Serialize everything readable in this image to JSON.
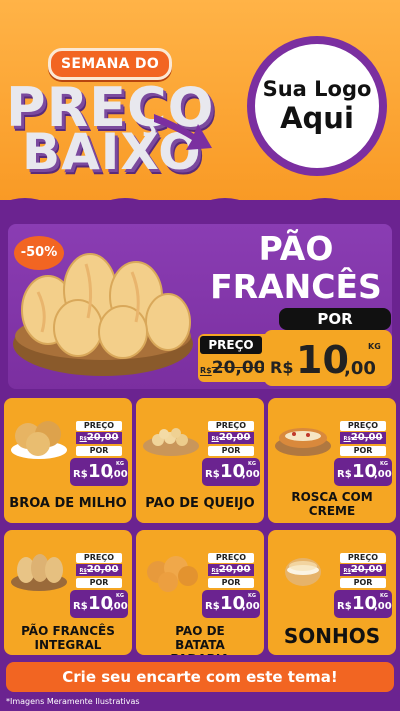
{
  "header": {
    "week_label": "SEMANA DO",
    "title_line1": "PREÇO",
    "title_line2": "BAIXO",
    "logo_line1": "Sua Logo",
    "logo_line2": "Aqui"
  },
  "hero": {
    "discount": "-50%",
    "title_line1": "PÃO",
    "title_line2": "FRANCÊS",
    "preco_label": "PREÇO",
    "old_currency": "R$",
    "old_price": "20,00",
    "por_label": "POR",
    "currency": "R$",
    "price_int": "10",
    "price_cents": ",00",
    "unit": "KG"
  },
  "cards": [
    {
      "name": "BROA DE MILHO",
      "preco_label": "PREÇO",
      "old_currency": "R$",
      "old_price": "20,00",
      "por_label": "POR",
      "currency": "R$",
      "price_int": "10",
      "price_cents": ",00",
      "unit": "KG"
    },
    {
      "name": "PAO DE QUEIJO",
      "preco_label": "PREÇO",
      "old_currency": "R$",
      "old_price": "20,00",
      "por_label": "POR",
      "currency": "R$",
      "price_int": "10",
      "price_cents": ",00",
      "unit": "KG"
    },
    {
      "name": "ROSCA COM CREME",
      "preco_label": "PREÇO",
      "old_currency": "R$",
      "old_price": "20,00",
      "por_label": "POR",
      "currency": "R$",
      "price_int": "10",
      "price_cents": ",00",
      "unit": "KG"
    },
    {
      "name": "PÃO FRANCÊS INTEGRAL",
      "preco_label": "PREÇO",
      "old_currency": "R$",
      "old_price": "20,00",
      "por_label": "POR",
      "currency": "R$",
      "price_int": "10",
      "price_cents": ",00",
      "unit": "KG"
    },
    {
      "name": "PAO DE BATATA PADARIA",
      "preco_label": "PREÇO",
      "old_currency": "R$",
      "old_price": "20,00",
      "por_label": "POR",
      "currency": "R$",
      "price_int": "10",
      "price_cents": ",00",
      "unit": "KG"
    },
    {
      "name": "SONHOS",
      "preco_label": "PREÇO",
      "old_currency": "R$",
      "old_price": "20,00",
      "por_label": "POR",
      "currency": "R$",
      "price_int": "10",
      "price_cents": ",00",
      "unit": "KG"
    }
  ],
  "cta": "Crie seu encarte com este tema!",
  "footer_note": "*Imagens Meramente Ilustrativas",
  "colors": {
    "purple": "#6b2390",
    "orange": "#f7941d",
    "accent": "#f26522",
    "price_bg": "#f5a623"
  }
}
